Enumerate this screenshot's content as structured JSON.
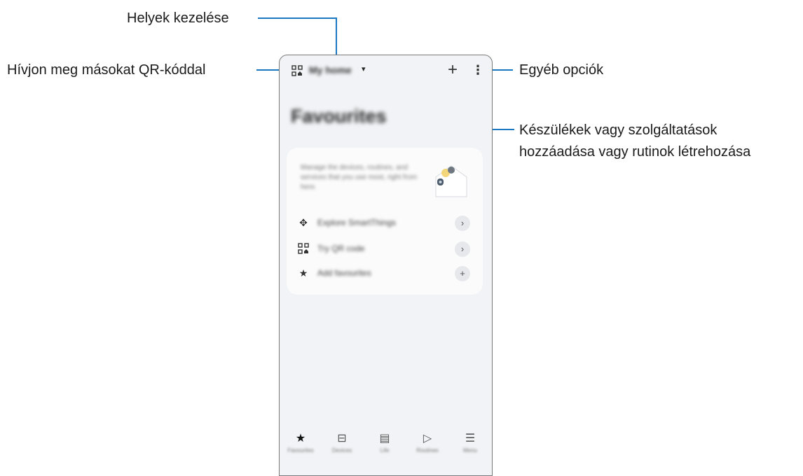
{
  "callouts": {
    "manage_locations": "Helyek kezelése",
    "invite_qr": "Hívjon meg másokat QR-kóddal",
    "other_options": "Egyéb opciók",
    "add_devices_line1": "Készülékek vagy szolgáltatások",
    "add_devices_line2": "hozzáadása vagy rutinok létrehozása"
  },
  "phone": {
    "location_selector": "My home",
    "caret": "▾",
    "qr_icon": "qr-code-icon",
    "add_glyph": "+",
    "more_glyph": "⋮",
    "favourites_title": "Favourites",
    "card": {
      "description": "Manage the devices, routines, and services that you use most, right from here.",
      "rows": [
        {
          "icon": "✥",
          "label": "Explore SmartThings",
          "action": "›"
        },
        {
          "icon": "⊞",
          "label": "Try QR code",
          "action": "›"
        },
        {
          "icon": "★",
          "label": "Add favourites",
          "action": "+"
        }
      ]
    },
    "nav": [
      {
        "icon": "★",
        "label": "Favourites"
      },
      {
        "icon": "⊟",
        "label": "Devices"
      },
      {
        "icon": "▤",
        "label": "Life"
      },
      {
        "icon": "▷",
        "label": "Routines"
      },
      {
        "icon": "☰",
        "label": "Menu"
      }
    ]
  },
  "colors": {
    "callout_line": "#1a78c2",
    "phone_bg": "#f1f3f6"
  }
}
